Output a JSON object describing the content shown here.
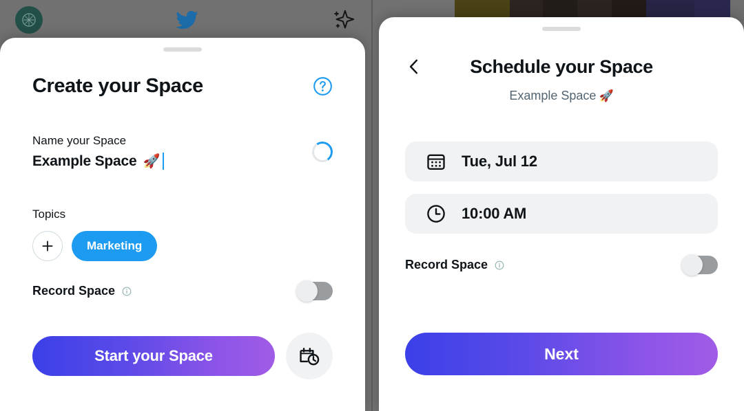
{
  "left_screen": {
    "topbar": {
      "avatar_name": "profile-avatar",
      "logo_name": "twitter-bird-logo",
      "sparkle_name": "sparkle-icon"
    },
    "title": "Create your Space",
    "help_icon": "help-circle-icon",
    "name_field": {
      "label": "Name your Space",
      "value": "Example Space",
      "emoji": "🚀",
      "status": "loading-spinner"
    },
    "topics": {
      "label": "Topics",
      "add_label": "+",
      "chips": [
        {
          "label": "Marketing",
          "color": "#1d9bf0"
        }
      ]
    },
    "record": {
      "label": "Record Space",
      "info_icon": "info-circle-icon",
      "toggle_state": "off"
    },
    "primary_button": "Start your Space",
    "schedule_button_icon": "calendar-clock-icon"
  },
  "right_screen": {
    "back_icon": "back-chevron-icon",
    "title": "Schedule your Space",
    "subtitle": "Example Space",
    "subtitle_emoji": "🚀",
    "fields": [
      {
        "icon": "calendar-icon",
        "value": "Tue, Jul 12"
      },
      {
        "icon": "clock-icon",
        "value": "10:00 AM"
      }
    ],
    "record": {
      "label": "Record Space",
      "info_icon": "info-circle-icon",
      "toggle_state": "off"
    },
    "primary_button": "Next",
    "background_strips": [
      "#717171",
      "#4a4115",
      "#2c2420",
      "#231d1a",
      "#2b2320",
      "#221a17",
      "#272545",
      "#2b2850",
      "#6e6e6e"
    ]
  },
  "colors": {
    "twitter_blue": "#1d9bf0",
    "gradient_start": "#3b40e8",
    "gradient_end": "#a05ce6",
    "text_primary": "#0f1419",
    "text_secondary": "#536471",
    "pill_bg": "#f0f2f3"
  }
}
